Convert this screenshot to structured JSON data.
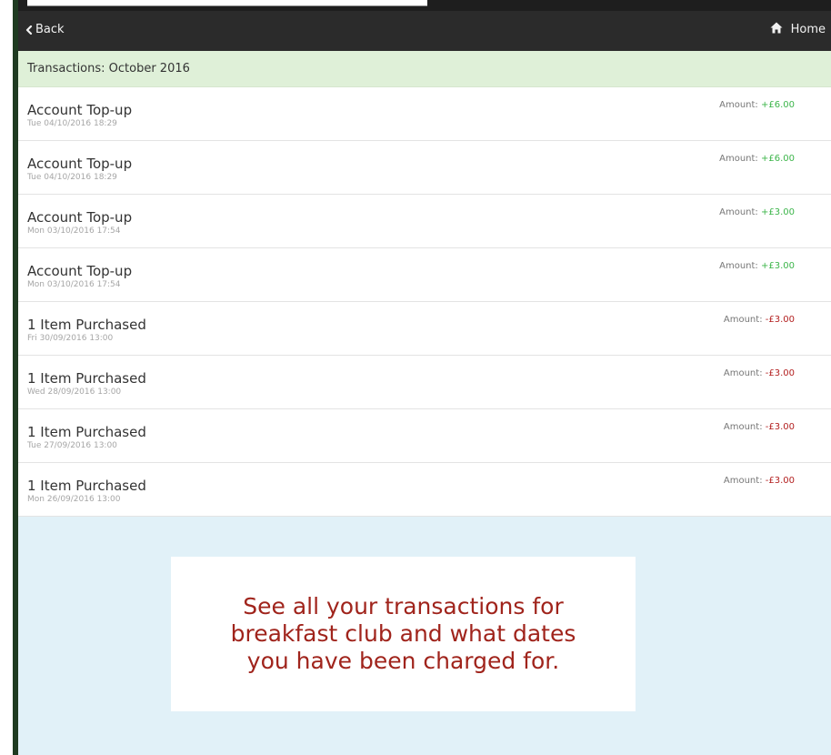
{
  "navbar": {
    "back_label": "Back",
    "home_label": "Home",
    "back_icon": "chevron-left-icon",
    "home_icon": "home-icon"
  },
  "header": {
    "title": "Transactions: October 2016"
  },
  "transactions": [
    {
      "title": "Account Top-up",
      "date": "Tue 04/10/2016 18:29",
      "amount_label": "Amount:",
      "amount_value": "+£6.00",
      "type": "credit"
    },
    {
      "title": "Account Top-up",
      "date": "Tue 04/10/2016 18:29",
      "amount_label": "Amount:",
      "amount_value": "+£6.00",
      "type": "credit"
    },
    {
      "title": "Account Top-up",
      "date": "Mon 03/10/2016 17:54",
      "amount_label": "Amount:",
      "amount_value": "+£3.00",
      "type": "credit"
    },
    {
      "title": "Account Top-up",
      "date": "Mon 03/10/2016 17:54",
      "amount_label": "Amount:",
      "amount_value": "+£3.00",
      "type": "credit"
    },
    {
      "title": "1 Item Purchased",
      "date": "Fri 30/09/2016 13:00",
      "amount_label": "Amount:",
      "amount_value": "-£3.00",
      "type": "debit"
    },
    {
      "title": "1 Item Purchased",
      "date": "Wed 28/09/2016 13:00",
      "amount_label": "Amount:",
      "amount_value": "-£3.00",
      "type": "debit"
    },
    {
      "title": "1 Item Purchased",
      "date": "Tue 27/09/2016 13:00",
      "amount_label": "Amount:",
      "amount_value": "-£3.00",
      "type": "debit"
    },
    {
      "title": "1 Item Purchased",
      "date": "Mon 26/09/2016 13:00",
      "amount_label": "Amount:",
      "amount_value": "-£3.00",
      "type": "debit"
    }
  ],
  "promo": {
    "text": "See all your transactions for breakfast club and what dates you have been charged for."
  },
  "colors": {
    "navbar": "#2b2b2b",
    "header_bg": "#dff0d8",
    "credit": "#3cb54a",
    "debit": "#b32020",
    "promo_bg": "#e1f1f8",
    "promo_text": "#a0241c"
  }
}
